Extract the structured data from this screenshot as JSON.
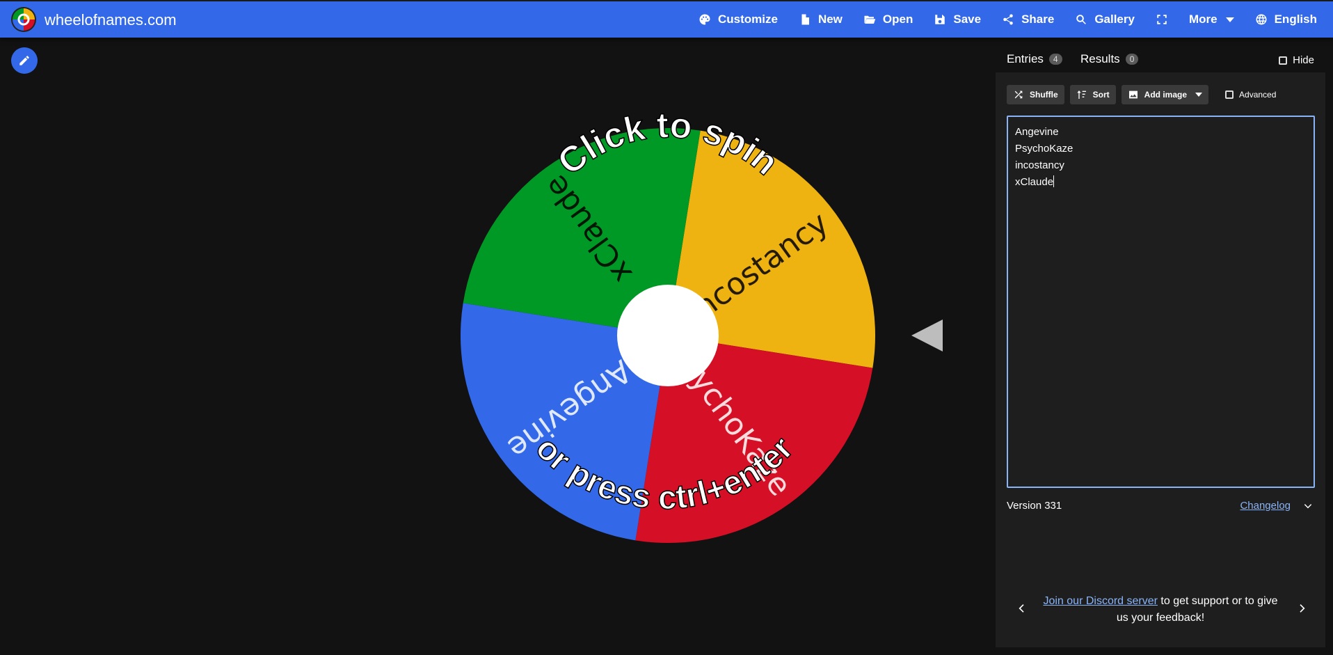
{
  "app": {
    "title": "wheelofnames.com"
  },
  "nav": [
    {
      "key": "customize",
      "label": "Customize",
      "icon": "palette-icon"
    },
    {
      "key": "new",
      "label": "New",
      "icon": "file-icon"
    },
    {
      "key": "open",
      "label": "Open",
      "icon": "folder-open-icon"
    },
    {
      "key": "save",
      "label": "Save",
      "icon": "save-icon"
    },
    {
      "key": "share",
      "label": "Share",
      "icon": "share-icon"
    },
    {
      "key": "gallery",
      "label": "Gallery",
      "icon": "search-icon"
    },
    {
      "key": "fullscreen",
      "label": "",
      "icon": "fullscreen-icon"
    },
    {
      "key": "more",
      "label": "More",
      "icon": "caret-down-icon"
    },
    {
      "key": "language",
      "label": "English",
      "icon": "globe-icon"
    }
  ],
  "wheel": {
    "slices": [
      {
        "label": "incostancy",
        "color": "#eeb211"
      },
      {
        "label": "PsychoKaze",
        "color": "#d50f25"
      },
      {
        "label": "Angevine",
        "color": "#3369e8"
      },
      {
        "label": "xClaude",
        "color": "#009925"
      }
    ],
    "center_color": "#ffffff",
    "overlay_top": "Click to spin",
    "overlay_bottom": "or press ctrl+enter"
  },
  "panel": {
    "tabs": [
      {
        "label": "Entries",
        "count": "4"
      },
      {
        "label": "Results",
        "count": "0"
      }
    ],
    "hide_label": "Hide",
    "tools": {
      "shuffle": "Shuffle",
      "sort": "Sort",
      "add_image": "Add image",
      "advanced": "Advanced"
    },
    "entries": [
      "Angevine",
      "PsychoKaze",
      "incostancy",
      "xClaude"
    ],
    "version": "Version 331",
    "changelog": "Changelog",
    "discord": {
      "link": "Join our Discord server",
      "rest": " to get support or to give us your feedback!"
    }
  }
}
